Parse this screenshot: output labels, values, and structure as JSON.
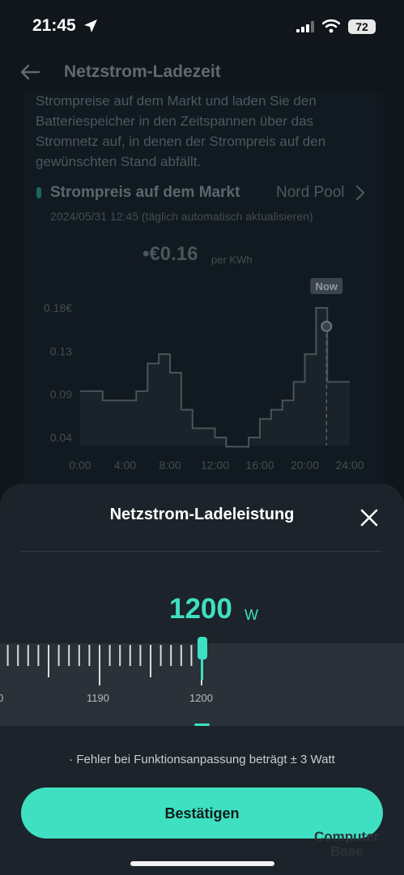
{
  "status": {
    "time": "21:45",
    "battery": "72"
  },
  "header": {
    "title": "Netzstrom-Ladezeit"
  },
  "description": "Strompreise auf dem Markt und laden Sie den Batteriespeicher in den Zeitspannen über das Stromnetz auf, in denen der Strompreis auf den gewünschten Stand abfällt.",
  "market": {
    "title": "Strompreis auf dem Markt",
    "source": "Nord Pool",
    "updated": "2024/05/31 12:45 (täglich automatisch aktualisieren)",
    "price": "•€0.16",
    "price_unit": "per KWh",
    "now_label": "Now"
  },
  "chart_data": {
    "type": "area",
    "step": true,
    "x_ticks": [
      "0:00",
      "4:00",
      "8:00",
      "12:00",
      "16:00",
      "20:00",
      "24:00"
    ],
    "y_ticks": [
      "0.18€",
      "0.13",
      "0.09",
      "0.04"
    ],
    "ylim": [
      0.04,
      0.18
    ],
    "hours": [
      0,
      1,
      2,
      3,
      4,
      5,
      6,
      7,
      8,
      9,
      10,
      11,
      12,
      13,
      14,
      15,
      16,
      17,
      18,
      19,
      20,
      21,
      22,
      23
    ],
    "values": [
      0.09,
      0.09,
      0.08,
      0.08,
      0.08,
      0.09,
      0.12,
      0.13,
      0.11,
      0.07,
      0.05,
      0.05,
      0.04,
      0.03,
      0.03,
      0.04,
      0.06,
      0.07,
      0.08,
      0.1,
      0.13,
      0.18,
      0.1,
      0.1
    ],
    "now_hour": 22,
    "now_value": 0.16
  },
  "sheet": {
    "title": "Netzstrom-Ladeleistung",
    "value": "1200",
    "unit": "W",
    "ruler_labels": [
      "0",
      "1190",
      "1200"
    ],
    "note": "· Fehler bei Funktionsanpassung beträgt ± 3 Watt",
    "confirm_label": "Bestätigen"
  },
  "watermark": {
    "line1": "Computer",
    "line2": "Base"
  },
  "colors": {
    "accent": "#3fe0c2",
    "sheet": "#1c232a",
    "background": "#10161b"
  }
}
